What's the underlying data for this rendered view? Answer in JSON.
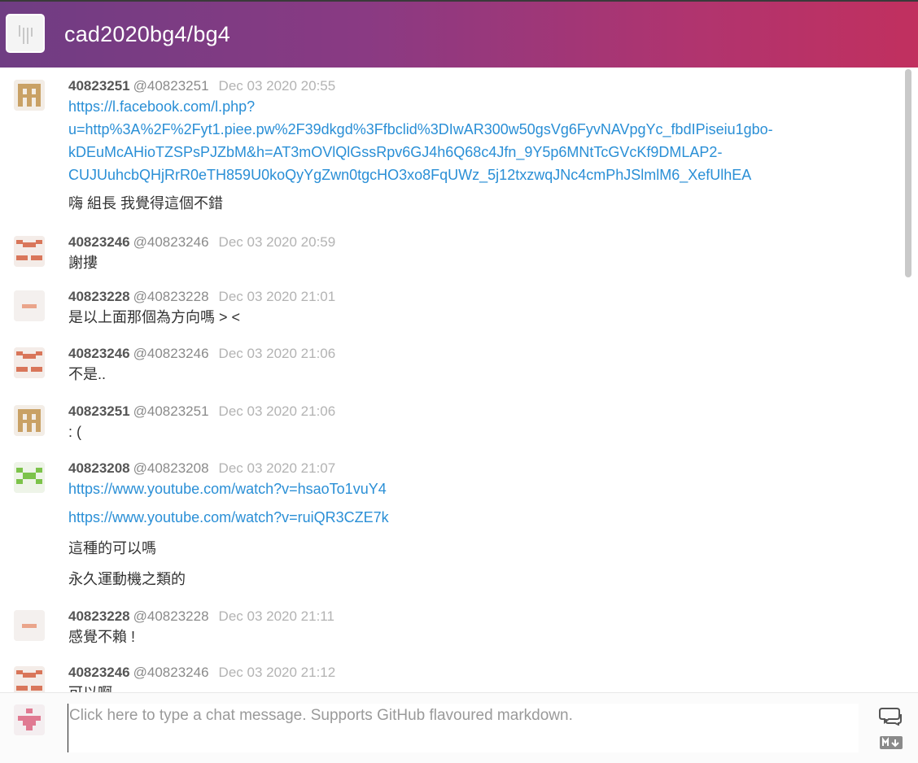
{
  "header": {
    "room_title": "cad2020bg4/bg4"
  },
  "messages": [
    {
      "avatar": "avatar-pixel-tan",
      "username": "40823251",
      "handle": "@40823251",
      "time": "Dec 03 2020 20:55",
      "lines": [
        "https://l.facebook.com/l.php?",
        "u=http%3A%2F%2Fyt1.piee.pw%2F39dkgd%3Ffbclid%3DIwAR300w50gsVg6FyvNAVpgYc_fbdIPiseiu1gbo-",
        "kDEuMcAHioTZSPsPJZbM&h=AT3mOVlQlGssRpv6GJ4h6Q68c4Jfn_9Y5p6MNtTcGVcKf9DMLAP2-",
        "CUJUuhcbQHjRrR0eTH859U0koQyYgZwn0tgcHO3xo8FqUWz_5j12txzwqJNc4cmPhJSlmlM6_XefUlhEA",
        "嗨 組長 我覺得這個不錯"
      ]
    },
    {
      "avatar": "avatar-pixel-orange",
      "username": "40823246",
      "handle": "@40823246",
      "time": "Dec 03 2020 20:59",
      "lines": [
        "謝摟"
      ]
    },
    {
      "avatar": "avatar-pixel-salmon",
      "username": "40823228",
      "handle": "@40823228",
      "time": "Dec 03 2020 21:01",
      "lines": [
        "是以上面那個為方向嗎 > <"
      ]
    },
    {
      "avatar": "avatar-pixel-orange",
      "username": "40823246",
      "handle": "@40823246",
      "time": "Dec 03 2020 21:06",
      "lines": [
        "不是.."
      ]
    },
    {
      "avatar": "avatar-pixel-tan",
      "username": "40823251",
      "handle": "@40823251",
      "time": "Dec 03 2020 21:06",
      "lines": [
        ": ("
      ]
    },
    {
      "avatar": "avatar-pixel-green",
      "username": "40823208",
      "handle": "@40823208",
      "time": "Dec 03 2020 21:07",
      "lines": [
        "https://www.youtube.com/watch?v=hsaoTo1vuY4",
        "https://www.youtube.com/watch?v=ruiQR3CZE7k",
        "這種的可以嗎",
        "永久運動機之類的"
      ]
    },
    {
      "avatar": "avatar-pixel-salmon",
      "username": "40823228",
      "handle": "@40823228",
      "time": "Dec 03 2020 21:11",
      "lines": [
        "感覺不賴 !"
      ]
    },
    {
      "avatar": "avatar-pixel-orange",
      "username": "40823246",
      "handle": "@40823246",
      "time": "Dec 03 2020 21:12",
      "lines": [
        "可以啊"
      ]
    }
  ],
  "composer": {
    "placeholder": "Click here to type a chat message. Supports GitHub flavoured markdown.",
    "chat_icon": "chat-bubbles-icon",
    "markdown_icon": "markdown-icon"
  },
  "colors": {
    "header_start": "#6f3d83",
    "header_end": "#c1305f",
    "link": "#2a8fd6",
    "username": "#555555",
    "timestamp": "#b3b3b3"
  }
}
